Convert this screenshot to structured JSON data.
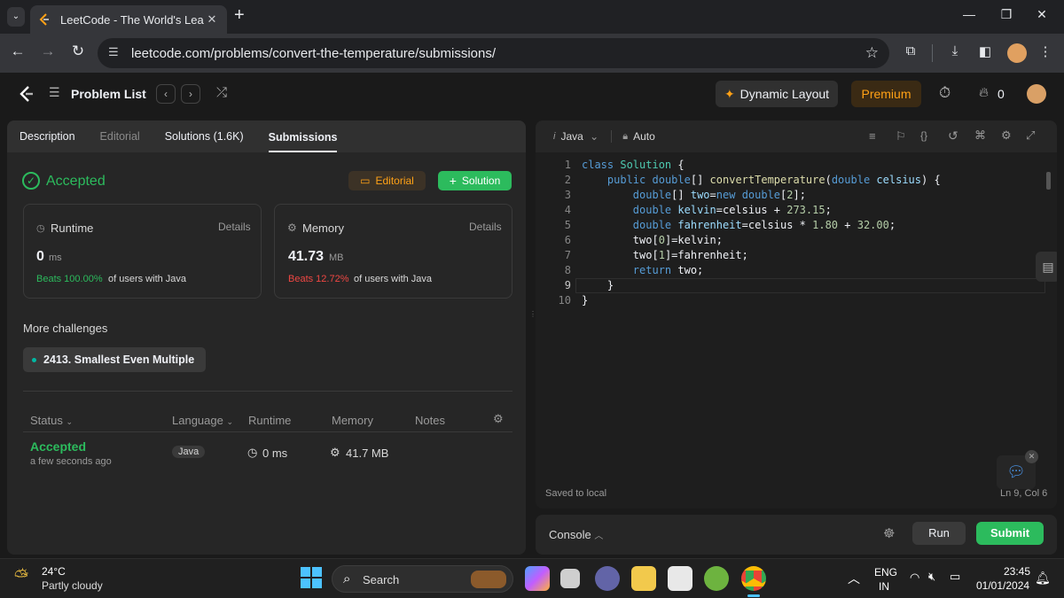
{
  "browser": {
    "tab_title": "LeetCode - The World's Leading",
    "tab_close": "✕",
    "new_tab": "+",
    "url": "leetcode.com/problems/convert-the-temperature/submissions/"
  },
  "nav": {
    "problem_list": "Problem List",
    "dynamic_layout": "Dynamic Layout",
    "premium": "Premium",
    "streak": "0"
  },
  "left_tabs": [
    "Description",
    "Editorial",
    "Solutions (1.6K)",
    "Submissions"
  ],
  "result": {
    "status": "Accepted",
    "editorial_btn": "Editorial",
    "solution_btn": "Solution",
    "runtime": {
      "label": "Runtime",
      "details": "Details",
      "value": "0",
      "unit": "ms",
      "beats": "Beats 100.00%",
      "beats_suffix": "of users with Java"
    },
    "memory": {
      "label": "Memory",
      "details": "Details",
      "value": "41.73",
      "unit": "MB",
      "beats": "Beats 12.72%",
      "beats_suffix": "of users with Java"
    },
    "more_challenges": "More challenges",
    "challenge": "2413. Smallest Even Multiple"
  },
  "table": {
    "headers": [
      "Status",
      "Language",
      "Runtime",
      "Memory",
      "Notes"
    ],
    "row": {
      "status": "Accepted",
      "time": "a few seconds ago",
      "language": "Java",
      "runtime": "0 ms",
      "memory": "41.7 MB"
    }
  },
  "editor": {
    "language": "Java",
    "mode": "Auto",
    "line_numbers": [
      "1",
      "2",
      "3",
      "4",
      "5",
      "6",
      "7",
      "8",
      "9",
      "10"
    ],
    "saved": "Saved to local",
    "cursor": "Ln 9, Col 6"
  },
  "console": {
    "label": "Console",
    "run": "Run",
    "submit": "Submit"
  },
  "taskbar": {
    "temp": "24°C",
    "weather": "Partly cloudy",
    "search": "Search",
    "lang1": "ENG",
    "lang2": "IN",
    "time": "23:45",
    "date": "01/01/2024"
  },
  "colors": {
    "accent_green": "#2cbb5d",
    "premium": "#ffa116",
    "red": "#ef4743"
  }
}
